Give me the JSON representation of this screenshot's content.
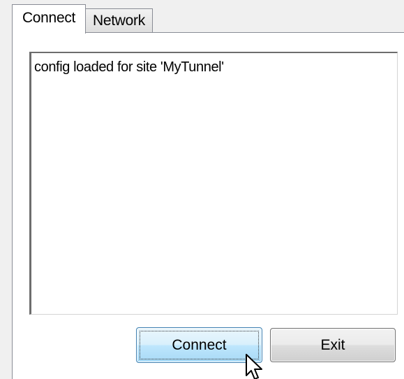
{
  "tabs": [
    {
      "label": "Connect",
      "selected": true
    },
    {
      "label": "Network",
      "selected": false
    }
  ],
  "log": {
    "lines": [
      "config loaded for site 'MyTunnel'"
    ]
  },
  "buttons": {
    "connect_label": "Connect",
    "exit_label": "Exit"
  },
  "colors": {
    "connect_button_border": "#3c7fb1",
    "connect_button_fill": "#bee6fd",
    "window_background": "#f0f0f0"
  },
  "cursor": {
    "icon": "arrow-pointer-icon"
  }
}
